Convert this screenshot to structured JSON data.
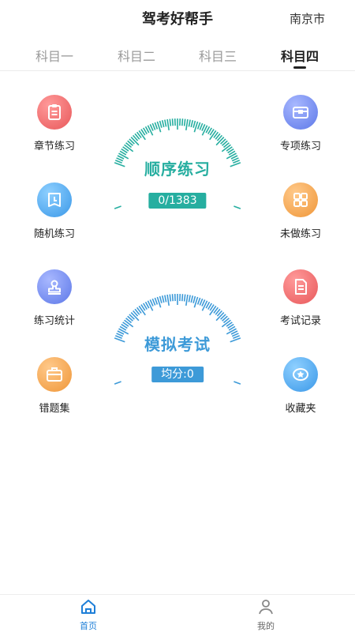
{
  "header": {
    "title": "驾考好帮手",
    "city": "南京市"
  },
  "tabs": [
    {
      "label": "科目一",
      "active": false
    },
    {
      "label": "科目二",
      "active": false
    },
    {
      "label": "科目三",
      "active": false
    },
    {
      "label": "科目四",
      "active": true
    }
  ],
  "features_left": [
    {
      "label": "章节练习",
      "icon": "clipboard-icon",
      "color": "#ee6b6b"
    },
    {
      "label": "随机练习",
      "icon": "clock-icon",
      "color": "#4aa8f0"
    },
    {
      "label": "练习统计",
      "icon": "stamp-icon",
      "color": "#6b86f0"
    },
    {
      "label": "错题集",
      "icon": "briefcase-icon",
      "color": "#f3a64b"
    }
  ],
  "features_right": [
    {
      "label": "专项练习",
      "icon": "box-icon",
      "color": "#6b86f0"
    },
    {
      "label": "未做练习",
      "icon": "grid-icon",
      "color": "#f3a64b"
    },
    {
      "label": "考试记录",
      "icon": "document-icon",
      "color": "#ee6b6b"
    },
    {
      "label": "收藏夹",
      "icon": "star-badge-icon",
      "color": "#4aa8f0"
    }
  ],
  "gauges": {
    "sequential": {
      "title": "顺序练习",
      "value": "0/1383",
      "color": "#26aea0"
    },
    "mock_exam": {
      "title": "模拟考试",
      "value": "均分:0",
      "color": "#3d9ad8"
    }
  },
  "bottom_nav": [
    {
      "label": "首页",
      "icon": "home-icon",
      "active": true
    },
    {
      "label": "我的",
      "icon": "user-icon",
      "active": false
    }
  ],
  "colors": {
    "active_nav": "#1e7fd8",
    "inactive_nav": "#666666"
  }
}
